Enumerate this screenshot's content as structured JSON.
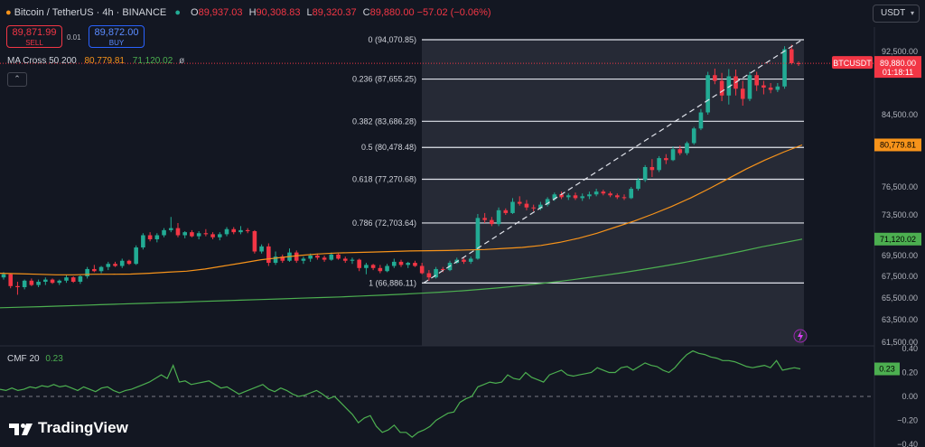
{
  "header": {
    "symbol": "Bitcoin / TetherUS · 4h · BINANCE",
    "o_label": "O",
    "o": "89,937.03",
    "h_label": "H",
    "h": "90,308.83",
    "l_label": "L",
    "l": "89,320.37",
    "c_label": "C",
    "c": "89,880.00 −57.02 (−0.06%)"
  },
  "trade": {
    "sell_price": "89,871.99",
    "sell_label": "SELL",
    "spread": "0.01",
    "buy_price": "89,872.00",
    "buy_label": "BUY"
  },
  "indicator": {
    "name": "MA Cross 50 200",
    "ma50": "80,779.81",
    "ma200": "71,120.02",
    "extra": "ø"
  },
  "cmf_panel": {
    "name": "CMF 20",
    "value": "0.23"
  },
  "currency": "USDT",
  "brand": "TradingView",
  "colors": {
    "up": "#22ab94",
    "down": "#f23645",
    "ma50": "#f7931a",
    "ma200": "#4caf50",
    "bg": "#131722"
  },
  "chart_data": {
    "type": "candlestick",
    "price_axis": {
      "ticks": [
        92500,
        88500,
        84500,
        80500,
        76500,
        73500,
        69500,
        67500,
        65500,
        63500,
        61500
      ],
      "tick_labels": [
        "92,500.00",
        "88,500.00",
        "84,500.00",
        "80,500.00",
        "76,500.00",
        "73,500.00",
        "69,500.00",
        "67,500.00",
        "65,500.00",
        "63,500.00",
        "61,500.00"
      ]
    },
    "fibonacci": {
      "levels": [
        {
          "ratio": "0",
          "price": 94070.85,
          "label": "0 (94,070.85)"
        },
        {
          "ratio": "0.236",
          "price": 87655.25,
          "label": "0.236 (87,655.25)"
        },
        {
          "ratio": "0.382",
          "price": 83686.28,
          "label": "0.382 (83,686.28)"
        },
        {
          "ratio": "0.5",
          "price": 80478.48,
          "label": "0.5 (80,478.48)"
        },
        {
          "ratio": "0.618",
          "price": 77270.68,
          "label": "0.618 (77,270.68)"
        },
        {
          "ratio": "0.786",
          "price": 72703.64,
          "label": "0.786 (72,703.64)"
        },
        {
          "ratio": "1",
          "price": 66886.11,
          "label": "1 (66,886.11)"
        }
      ]
    },
    "last_price": {
      "value": 89880.0,
      "tag": "BTCUSDT",
      "label": "89,880.00",
      "countdown": "01:18:11"
    },
    "ma50_label": {
      "value": 80779.81,
      "label": "80,779.81"
    },
    "ma200_label": {
      "value": 71120.02,
      "label": "71,120.02"
    },
    "cmf": {
      "ticks": [
        0.4,
        0.2,
        0.0,
        -0.2,
        -0.4
      ],
      "tick_labels": [
        "0.40",
        "0.20",
        "0.00",
        "−0.20",
        "−0.40"
      ],
      "current": 0.23,
      "current_label": "0.23",
      "values": [
        0.06,
        0.05,
        0.07,
        0.05,
        0.06,
        0.08,
        0.07,
        0.09,
        0.08,
        0.1,
        0.08,
        0.09,
        0.07,
        0.05,
        0.08,
        0.06,
        0.04,
        0.07,
        0.08,
        0.05,
        0.03,
        0.05,
        0.06,
        0.08,
        0.1,
        0.12,
        0.15,
        0.18,
        0.15,
        0.26,
        0.12,
        0.13,
        0.1,
        0.11,
        0.12,
        0.13,
        0.1,
        0.07,
        0.08,
        0.05,
        0.02,
        0.04,
        0.06,
        0.08,
        0.1,
        0.06,
        0.04,
        0.07,
        0.05,
        0.02,
        0.0,
        0.01,
        0.03,
        0.05,
        0.02,
        -0.02,
        0.0,
        -0.05,
        -0.1,
        -0.15,
        -0.22,
        -0.18,
        -0.16,
        -0.25,
        -0.3,
        -0.28,
        -0.24,
        -0.3,
        -0.3,
        -0.34,
        -0.3,
        -0.28,
        -0.25,
        -0.2,
        -0.17,
        -0.14,
        -0.13,
        -0.05,
        -0.02,
        0.0,
        0.08,
        0.1,
        0.12,
        0.11,
        0.12,
        0.18,
        0.15,
        0.14,
        0.2,
        0.16,
        0.14,
        0.12,
        0.18,
        0.2,
        0.22,
        0.18,
        0.17,
        0.18,
        0.19,
        0.2,
        0.24,
        0.22,
        0.2,
        0.2,
        0.24,
        0.25,
        0.22,
        0.25,
        0.28,
        0.26,
        0.25,
        0.22,
        0.2,
        0.24,
        0.3,
        0.35,
        0.38,
        0.36,
        0.35,
        0.33,
        0.32,
        0.3,
        0.3,
        0.29,
        0.27,
        0.25,
        0.24,
        0.25,
        0.26,
        0.24,
        0.3,
        0.22,
        0.23,
        0.24,
        0.23
      ]
    },
    "ma50": [
      67800,
      67750,
      67700,
      67650,
      67650,
      67700,
      67700,
      67720,
      67800,
      67900,
      68000,
      68200,
      68500,
      68800,
      69100,
      69300,
      69500,
      69650,
      69750,
      69800,
      69850,
      69900,
      69950,
      69980,
      70000,
      70050,
      70100,
      70200,
      70300,
      70500,
      70800,
      71200,
      71700,
      72300,
      72900,
      73600,
      74400,
      75300,
      76300,
      77300,
      78300,
      79200,
      80000,
      80779.81
    ],
    "ma200": [
      64600,
      64650,
      64700,
      64760,
      64820,
      64880,
      64940,
      65000,
      65060,
      65120,
      65180,
      65240,
      65300,
      65360,
      65420,
      65480,
      65540,
      65600,
      65680,
      65760,
      65840,
      65940,
      66040,
      66160,
      66300,
      66460,
      66640,
      66840,
      67060,
      67300,
      67560,
      67840,
      68140,
      68460,
      68800,
      69160,
      69540,
      69940,
      70360,
      70740,
      71120.02
    ],
    "candles": [
      [
        67400,
        67900,
        67200,
        67700
      ],
      [
        67700,
        67800,
        66400,
        66600
      ],
      [
        66600,
        67000,
        65800,
        66500
      ],
      [
        66500,
        67200,
        66300,
        67100
      ],
      [
        67100,
        67300,
        66600,
        66700
      ],
      [
        66700,
        67200,
        66500,
        67000
      ],
      [
        67000,
        67400,
        66700,
        67200
      ],
      [
        67200,
        67300,
        66800,
        66900
      ],
      [
        66900,
        67200,
        66700,
        67100
      ],
      [
        67100,
        67600,
        66900,
        67400
      ],
      [
        67400,
        67500,
        66900,
        67000
      ],
      [
        67000,
        67600,
        66800,
        67500
      ],
      [
        67500,
        68400,
        67300,
        68200
      ],
      [
        68200,
        68600,
        67900,
        68000
      ],
      [
        68000,
        68500,
        67800,
        68400
      ],
      [
        68400,
        68900,
        68100,
        68700
      ],
      [
        68700,
        68900,
        68400,
        68500
      ],
      [
        68500,
        69200,
        68300,
        69000
      ],
      [
        69000,
        69100,
        68600,
        68700
      ],
      [
        68700,
        70500,
        68600,
        70300
      ],
      [
        70300,
        71700,
        70100,
        71500
      ],
      [
        71500,
        71800,
        70900,
        71100
      ],
      [
        71100,
        71700,
        70800,
        71500
      ],
      [
        71500,
        72200,
        71300,
        72000
      ],
      [
        72000,
        73300,
        71800,
        72200
      ],
      [
        72200,
        72700,
        71300,
        71500
      ],
      [
        71500,
        71900,
        71200,
        71800
      ],
      [
        71800,
        72000,
        71300,
        71400
      ],
      [
        71400,
        71900,
        71100,
        71700
      ],
      [
        71700,
        72100,
        71400,
        71600
      ],
      [
        71600,
        71800,
        71100,
        71300
      ],
      [
        71300,
        71800,
        71000,
        71600
      ],
      [
        71600,
        72300,
        71400,
        72100
      ],
      [
        72100,
        72300,
        71600,
        71800
      ],
      [
        71800,
        72400,
        71600,
        72000
      ],
      [
        72000,
        72200,
        71700,
        71900
      ],
      [
        71900,
        72000,
        69700,
        69900
      ],
      [
        69900,
        70600,
        69700,
        70400
      ],
      [
        70400,
        70700,
        68500,
        68800
      ],
      [
        68800,
        69900,
        68600,
        69400
      ],
      [
        69400,
        69600,
        68800,
        69000
      ],
      [
        69000,
        70200,
        68900,
        69800
      ],
      [
        69800,
        70000,
        68800,
        69000
      ],
      [
        69000,
        69400,
        68700,
        69200
      ],
      [
        69200,
        69700,
        68900,
        69500
      ],
      [
        69500,
        69700,
        69100,
        69300
      ],
      [
        69300,
        69500,
        68900,
        69100
      ],
      [
        69100,
        69800,
        69000,
        69600
      ],
      [
        69600,
        69700,
        69100,
        69200
      ],
      [
        69200,
        69400,
        68800,
        69000
      ],
      [
        69000,
        69300,
        68700,
        69100
      ],
      [
        69100,
        69200,
        68000,
        68300
      ],
      [
        68300,
        68800,
        67700,
        68600
      ],
      [
        68600,
        68700,
        68100,
        68300
      ],
      [
        68300,
        68600,
        67800,
        68000
      ],
      [
        68000,
        68700,
        67900,
        68500
      ],
      [
        68500,
        69200,
        68300,
        68900
      ],
      [
        68900,
        69100,
        68400,
        68600
      ],
      [
        68600,
        68900,
        68300,
        68800
      ],
      [
        68800,
        69000,
        68400,
        68500
      ],
      [
        68500,
        68800,
        67700,
        67800
      ],
      [
        67800,
        68100,
        67100,
        67400
      ],
      [
        67400,
        68400,
        67300,
        68200
      ],
      [
        68200,
        68400,
        67900,
        68100
      ],
      [
        68100,
        69000,
        68000,
        68800
      ],
      [
        68800,
        69300,
        68700,
        69100
      ],
      [
        69100,
        69300,
        68700,
        68900
      ],
      [
        68900,
        69400,
        68700,
        69200
      ],
      [
        69200,
        73600,
        69100,
        73200
      ],
      [
        73200,
        73700,
        72700,
        73000
      ],
      [
        73000,
        73300,
        72400,
        72600
      ],
      [
        72600,
        74300,
        72400,
        74000
      ],
      [
        74000,
        74200,
        73500,
        73700
      ],
      [
        73700,
        75300,
        73600,
        74900
      ],
      [
        74900,
        75500,
        74500,
        74700
      ],
      [
        74700,
        75100,
        74000,
        74300
      ],
      [
        74300,
        74600,
        73900,
        74200
      ],
      [
        74200,
        74900,
        74000,
        74600
      ],
      [
        74600,
        75400,
        74400,
        75200
      ],
      [
        75200,
        75900,
        75000,
        75700
      ],
      [
        75700,
        76000,
        75200,
        75400
      ],
      [
        75400,
        75800,
        75100,
        75600
      ],
      [
        75600,
        75900,
        75100,
        75300
      ],
      [
        75300,
        75800,
        75000,
        75500
      ],
      [
        75500,
        76000,
        75200,
        75700
      ],
      [
        75700,
        76300,
        75500,
        76000
      ],
      [
        76000,
        76200,
        75600,
        75800
      ],
      [
        75800,
        76000,
        75400,
        75600
      ],
      [
        75600,
        75800,
        75200,
        75400
      ],
      [
        75400,
        75700,
        75100,
        75300
      ],
      [
        75300,
        76500,
        75200,
        76300
      ],
      [
        76300,
        77400,
        76100,
        77200
      ],
      [
        77200,
        78700,
        77000,
        78500
      ],
      [
        78500,
        79300,
        77500,
        78200
      ],
      [
        78200,
        79600,
        78000,
        79400
      ],
      [
        79400,
        79800,
        78800,
        79200
      ],
      [
        79200,
        80600,
        79100,
        80300
      ],
      [
        80300,
        80700,
        79700,
        79900
      ],
      [
        79900,
        81200,
        79700,
        81000
      ],
      [
        81000,
        83000,
        80800,
        82800
      ],
      [
        82800,
        85000,
        82600,
        84700
      ],
      [
        84700,
        88300,
        84500,
        88000
      ],
      [
        88000,
        88700,
        87200,
        87500
      ],
      [
        87500,
        88200,
        85700,
        86200
      ],
      [
        86200,
        88600,
        85400,
        87900
      ],
      [
        87900,
        88500,
        86200,
        86800
      ],
      [
        86800,
        87500,
        85300,
        85900
      ],
      [
        85900,
        88300,
        85700,
        88000
      ],
      [
        88000,
        88300,
        86600,
        87100
      ],
      [
        87100,
        87500,
        86300,
        86900
      ],
      [
        86900,
        87300,
        86400,
        86700
      ],
      [
        86700,
        87300,
        86500,
        87000
      ],
      [
        87000,
        93200,
        86800,
        92800
      ],
      [
        92800,
        93400,
        89600,
        89900
      ],
      [
        89900,
        90300,
        89300,
        89880
      ]
    ]
  }
}
